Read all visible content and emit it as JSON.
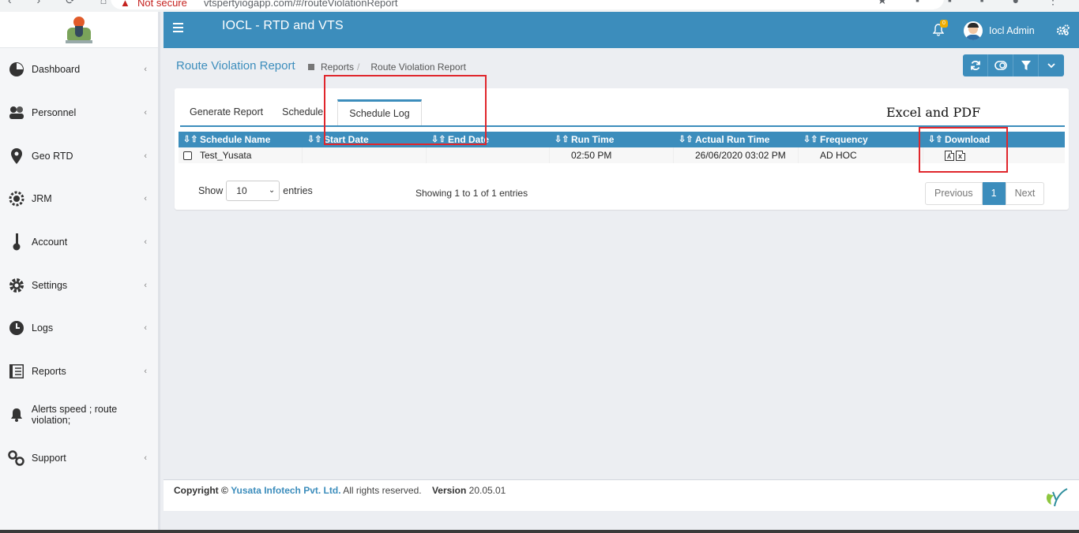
{
  "browser": {
    "security_label": "Not secure",
    "url": "vtspertyiogapp.com/#/routeViolationReport"
  },
  "app": {
    "title": "IOCL - RTD and VTS",
    "notification_count": "0",
    "user_name": "Iocl Admin"
  },
  "sidebar": {
    "items": [
      {
        "label": "Dashboard",
        "icon": "dashboard-icon"
      },
      {
        "label": "Personnel",
        "icon": "personnel-icon"
      },
      {
        "label": "Geo RTD",
        "icon": "map-marker-icon"
      },
      {
        "label": "JRM",
        "icon": "gear-steering-icon"
      },
      {
        "label": "Account",
        "icon": "key-icon"
      },
      {
        "label": "Settings",
        "icon": "settings-icon"
      },
      {
        "label": "Logs",
        "icon": "clock-icon"
      },
      {
        "label": "Reports",
        "icon": "report-icon"
      },
      {
        "label": "Alerts speed ; route violation;",
        "icon": "bell-icon"
      },
      {
        "label": "Support",
        "icon": "support-icon"
      }
    ]
  },
  "page": {
    "title": "Route Violation Report",
    "breadcrumb": {
      "parent": "Reports",
      "separator": "/",
      "current": "Route Violation Report"
    }
  },
  "tabs": [
    {
      "label": "Generate Report"
    },
    {
      "label": "Schedule"
    },
    {
      "label": "Schedule Log"
    }
  ],
  "annotation_note": "Excel and PDF",
  "table": {
    "columns": [
      "Schedule Name",
      "Start Date",
      "End Date",
      "Run Time",
      "Actual Run Time",
      "Frequency",
      "Download"
    ],
    "rows": [
      {
        "schedule_name": "Test_Yusata",
        "start_date": "",
        "end_date": "",
        "run_time": "02:50 PM",
        "actual_run_time": "26/06/2020 03:02 PM",
        "frequency": "AD HOC"
      }
    ]
  },
  "length_menu": {
    "prefix": "Show",
    "value": "10",
    "suffix": "entries"
  },
  "info": "Showing 1 to 1 of 1 entries",
  "pagination": {
    "previous": "Previous",
    "current": "1",
    "next": "Next"
  },
  "footer": {
    "copyright": "Copyright ©",
    "company": "Yusata Infotech Pvt. Ltd.",
    "rights": "All rights reserved.",
    "version_label": "Version",
    "version": "20.05.01"
  },
  "colors": {
    "primary": "#3c8dbc",
    "annotation": "#e0262c",
    "badge": "#f0ad00"
  }
}
